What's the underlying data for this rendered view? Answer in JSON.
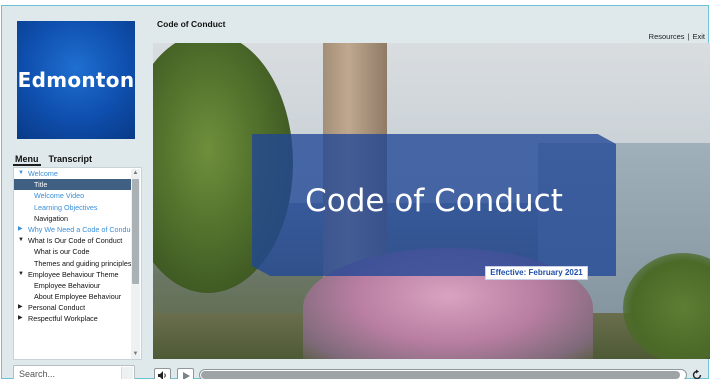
{
  "window": {
    "course_title": "Code of Conduct",
    "top_links": [
      "Resources",
      "Exit"
    ]
  },
  "logo": {
    "text": "Edmonton"
  },
  "sidebar": {
    "tabs": [
      {
        "label": "Menu",
        "active": true
      },
      {
        "label": "Transcript",
        "active": false
      }
    ],
    "items": [
      {
        "label": "Welcome",
        "level": 1,
        "arrow": "expanded",
        "visited": true
      },
      {
        "label": "Title",
        "level": 2,
        "selected": true
      },
      {
        "label": "Welcome Video",
        "level": 2,
        "visited": true
      },
      {
        "label": "Learning Objectives",
        "level": 2,
        "visited": true
      },
      {
        "label": "Navigation",
        "level": 2
      },
      {
        "label": "Why We Need a Code of Conduct",
        "level": 1,
        "arrow": "collapsed",
        "visited": true
      },
      {
        "label": "What Is Our Code of Conduct",
        "level": 1,
        "arrow": "expanded"
      },
      {
        "label": "What is our Code",
        "level": 2
      },
      {
        "label": "Themes and guiding principles",
        "level": 2
      },
      {
        "label": "Employee Behaviour Theme",
        "level": 1,
        "arrow": "expanded"
      },
      {
        "label": "Employee Behaviour",
        "level": 2
      },
      {
        "label": "About Employee Behaviour",
        "level": 2
      },
      {
        "label": "Personal Conduct",
        "level": 1,
        "arrow": "collapsed"
      },
      {
        "label": "Respectful Workplace",
        "level": 1,
        "arrow": "collapsed"
      }
    ]
  },
  "search": {
    "placeholder": "Search..."
  },
  "slide": {
    "title": "Code of Conduct",
    "effective_label": "Effective: February 2021"
  },
  "player": {
    "progress": 0.99
  },
  "colors": {
    "accent": "#3f5f83",
    "visited_link": "#3a8fd8",
    "title_box": "#2046a0",
    "frame_border": "#6bc3d6"
  }
}
